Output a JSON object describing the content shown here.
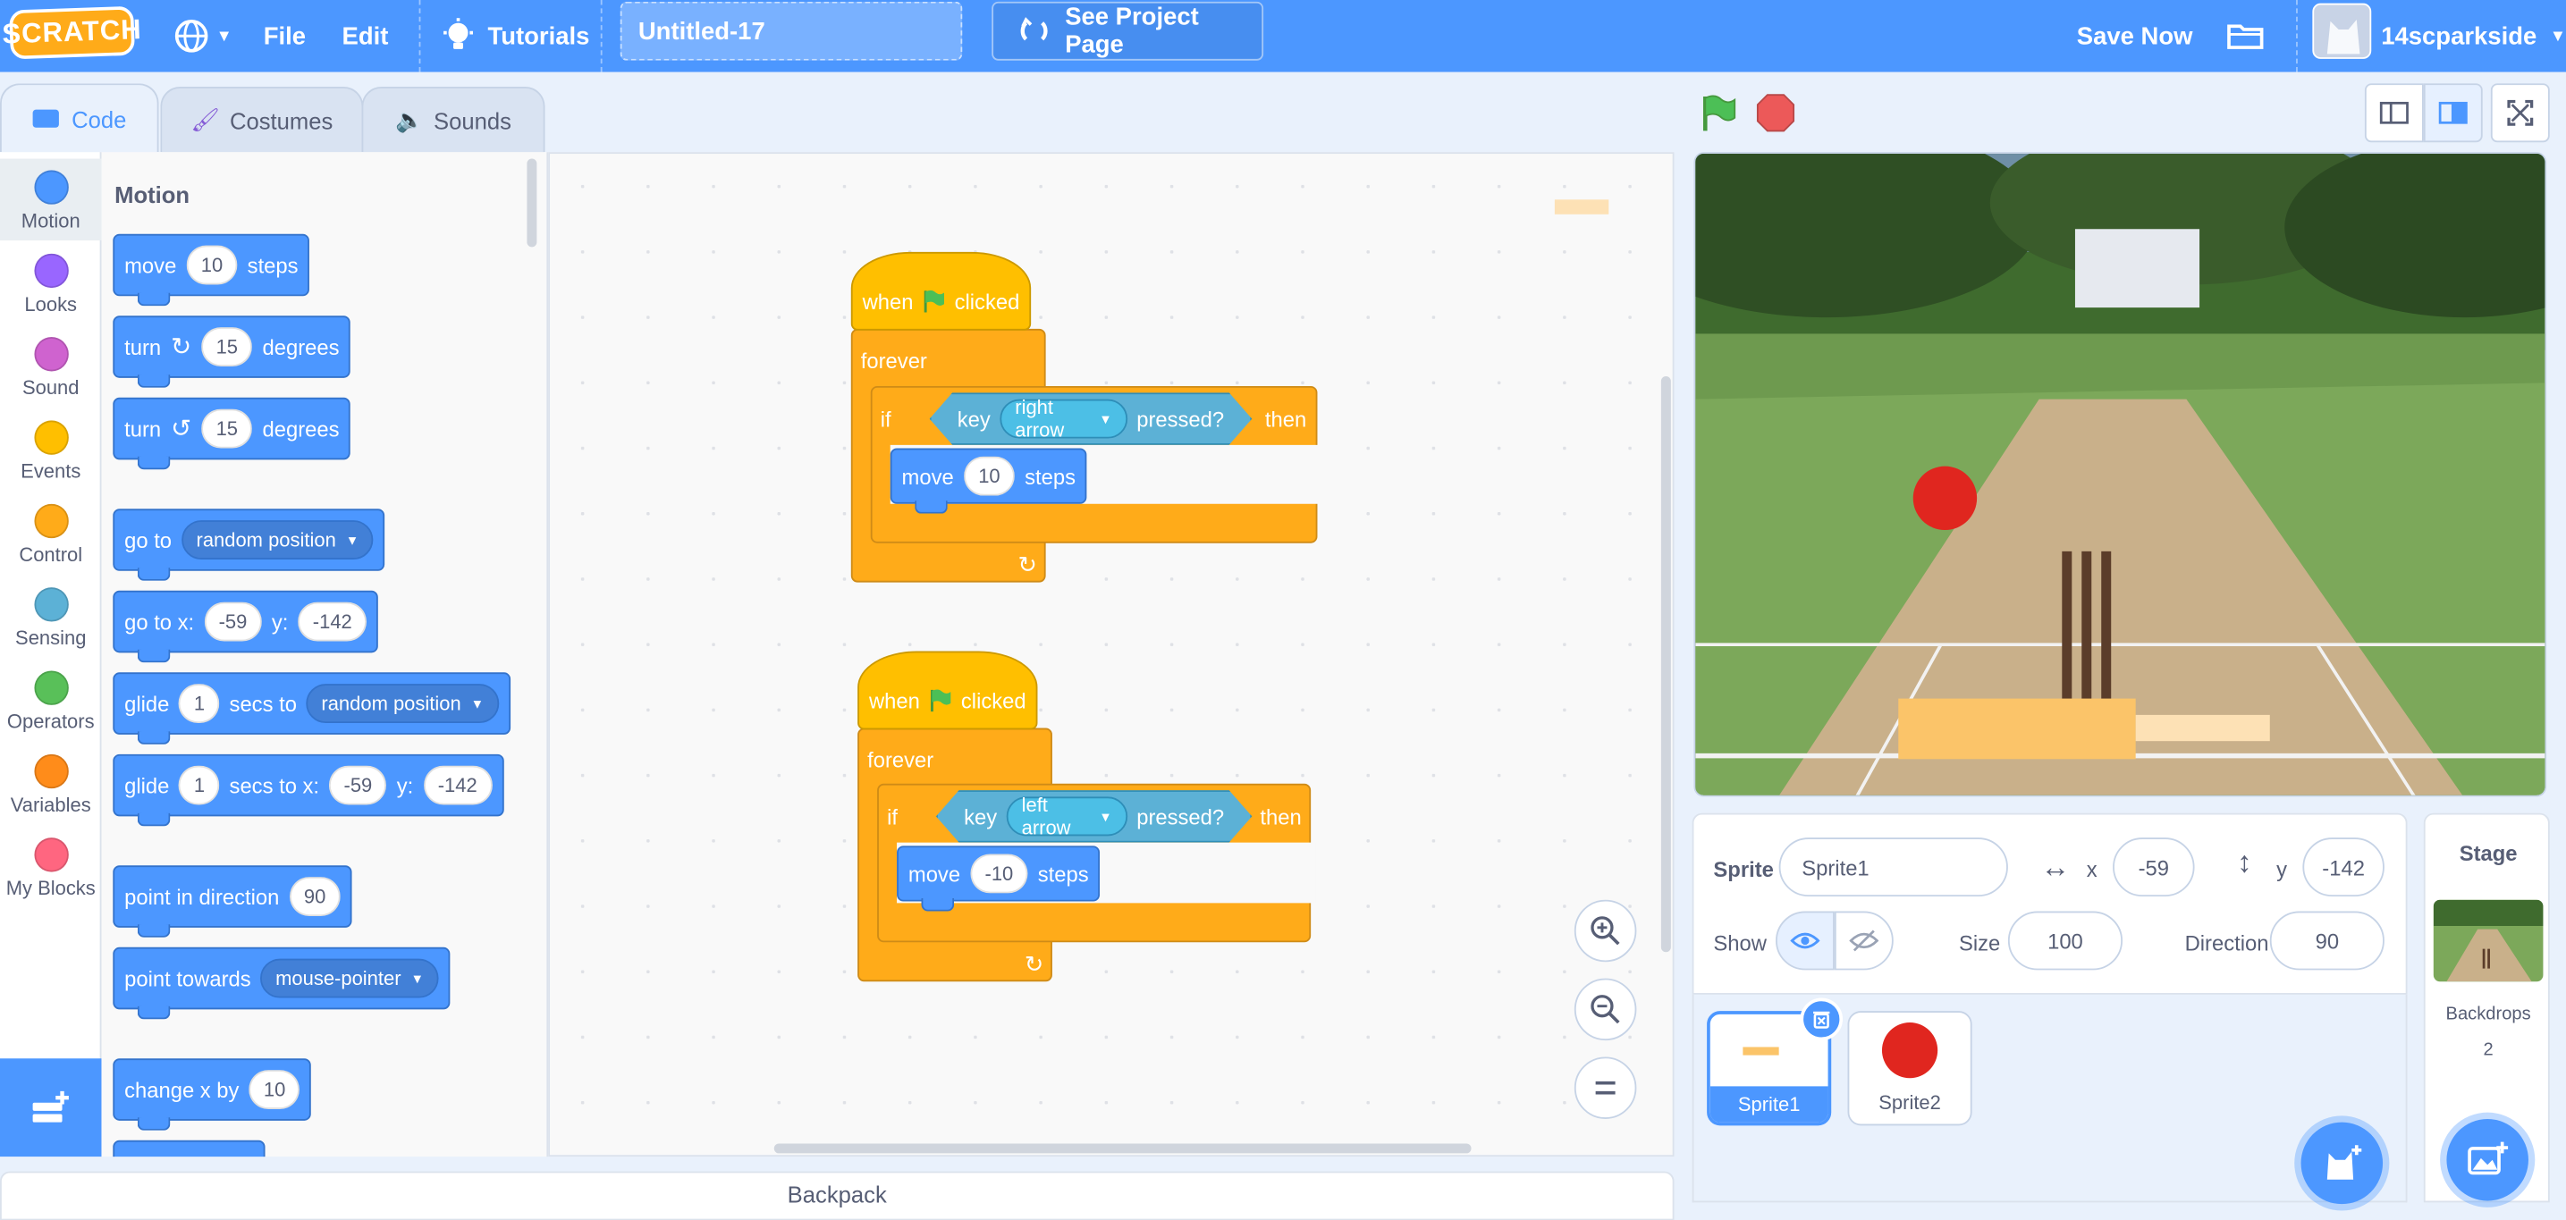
{
  "menubar": {
    "logo": "SCRATCH",
    "file": "File",
    "edit": "Edit",
    "tutorials": "Tutorials",
    "project_title": "Untitled-17",
    "see_project_page": "See Project Page",
    "save_now": "Save Now",
    "username": "14scparkside"
  },
  "tabs": {
    "code": "Code",
    "costumes": "Costumes",
    "sounds": "Sounds"
  },
  "categories": [
    {
      "label": "Motion",
      "color": "#4c97ff"
    },
    {
      "label": "Looks",
      "color": "#9966ff"
    },
    {
      "label": "Sound",
      "color": "#cf63cf"
    },
    {
      "label": "Events",
      "color": "#ffbf00"
    },
    {
      "label": "Control",
      "color": "#ffab19"
    },
    {
      "label": "Sensing",
      "color": "#5cb1d6"
    },
    {
      "label": "Operators",
      "color": "#59c059"
    },
    {
      "label": "Variables",
      "color": "#ff8c1a"
    },
    {
      "label": "My Blocks",
      "color": "#ff6680"
    }
  ],
  "palette": {
    "heading": "Motion",
    "move": {
      "t1": "move",
      "v": "10",
      "t2": "steps"
    },
    "turn_right": {
      "t1": "turn",
      "v": "15",
      "t2": "degrees"
    },
    "turn_left": {
      "t1": "turn",
      "v": "15",
      "t2": "degrees"
    },
    "goto": {
      "t1": "go to",
      "opt": "random position"
    },
    "goto_xy": {
      "t1": "go to x:",
      "x": "-59",
      "t2": "y:",
      "y": "-142"
    },
    "glide": {
      "t1": "glide",
      "v": "1",
      "t2": "secs to",
      "opt": "random position"
    },
    "glide_xy": {
      "t1": "glide",
      "v": "1",
      "t2": "secs to x:",
      "x": "-59",
      "t3": "y:",
      "y": "-142"
    },
    "point_dir": {
      "t1": "point in direction",
      "v": "90"
    },
    "point_towards": {
      "t1": "point towards",
      "opt": "mouse-pointer"
    },
    "change_x": {
      "t1": "change x by",
      "v": "10"
    }
  },
  "scripts": [
    {
      "when": "when",
      "clicked": "clicked",
      "forever": "forever",
      "if": "if",
      "key": "key",
      "keyname": "right arrow",
      "pressed": "pressed?",
      "then": "then",
      "move": "move",
      "steps_val": "10",
      "steps": "steps"
    },
    {
      "when": "when",
      "clicked": "clicked",
      "forever": "forever",
      "if": "if",
      "key": "key",
      "keyname": "left arrow",
      "pressed": "pressed?",
      "then": "then",
      "move": "move",
      "steps_val": "-10",
      "steps": "steps"
    }
  ],
  "sprite_info": {
    "sprite_label": "Sprite",
    "sprite_name": "Sprite1",
    "x_label": "x",
    "x": "-59",
    "y_label": "y",
    "y": "-142",
    "show_label": "Show",
    "size_label": "Size",
    "size": "100",
    "direction_label": "Direction",
    "direction": "90"
  },
  "sprites": [
    {
      "name": "Sprite1"
    },
    {
      "name": "Sprite2"
    }
  ],
  "stage_panel": {
    "title": "Stage",
    "backdrops_label": "Backdrops",
    "backdrops_count": "2"
  },
  "backpack": "Backpack"
}
